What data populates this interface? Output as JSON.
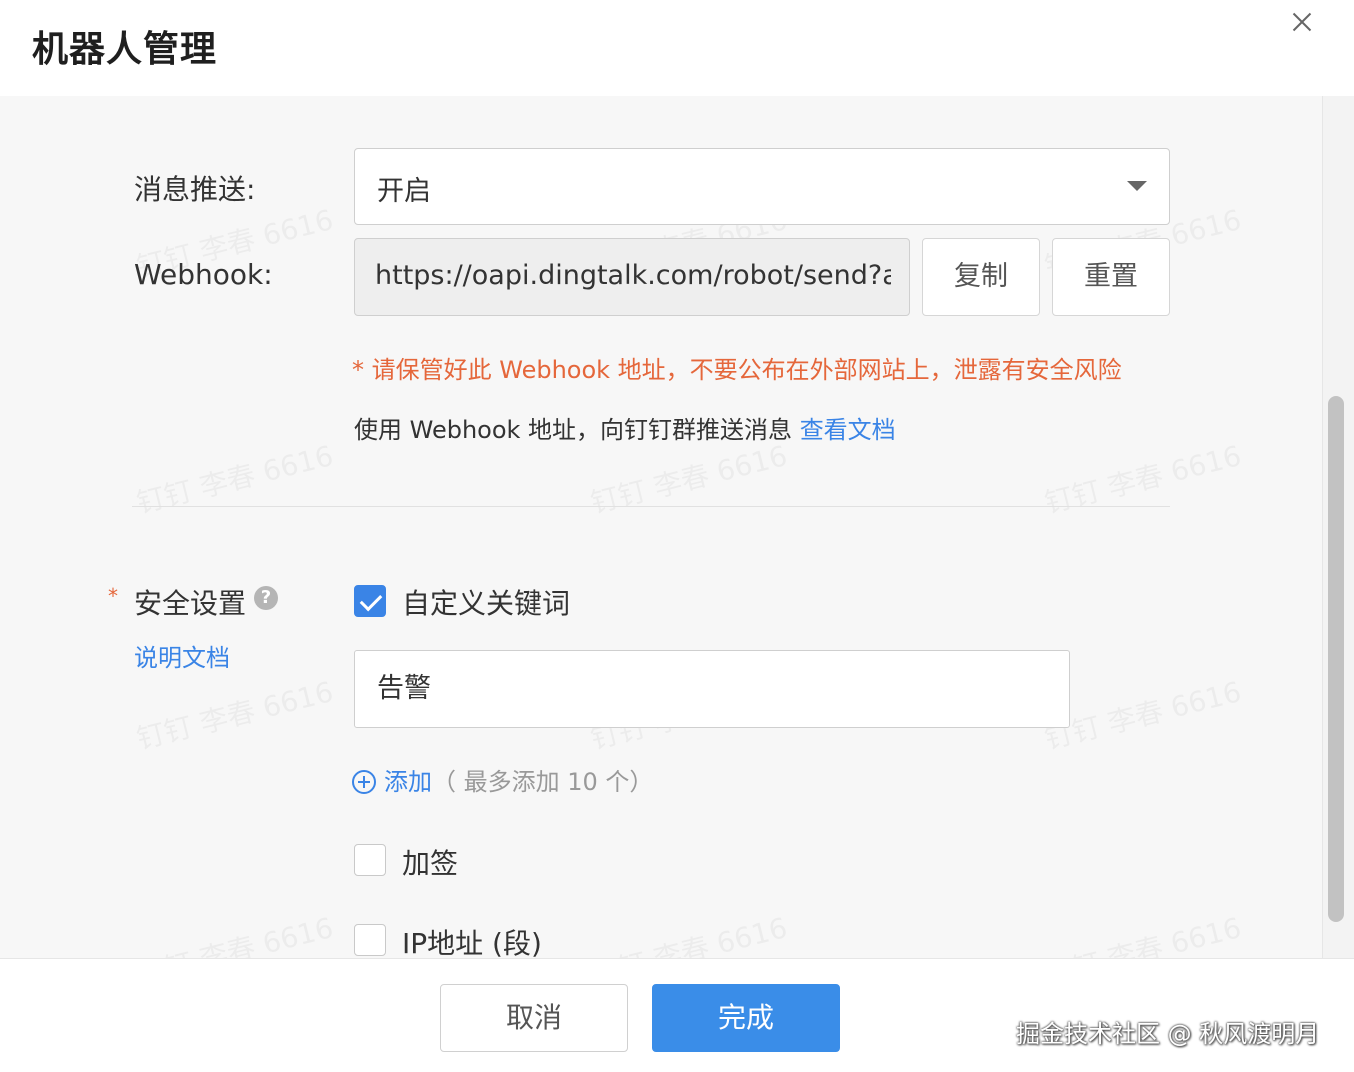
{
  "dialog": {
    "title": "机器人管理",
    "close_icon": "close-icon"
  },
  "watermark": {
    "text": "钉钉 李春 6616"
  },
  "push": {
    "label": "消息推送:",
    "value": "开启",
    "arrow_icon": "caret-down-icon"
  },
  "webhook": {
    "label": "Webhook:",
    "url": "https://oapi.dingtalk.com/robot/send?a",
    "copy_label": "复制",
    "reset_label": "重置",
    "warning": "* 请保管好此 Webhook 地址，不要公布在外部网站上，泄露有安全风险",
    "info_prefix": "使用 Webhook 地址，向钉钉群推送消息 ",
    "info_link": "查看文档"
  },
  "security": {
    "required_mark": "*",
    "label": "安全设置",
    "help_icon": "?",
    "doc_link": "说明文档",
    "options": [
      {
        "label": "自定义关键词",
        "checked": true
      },
      {
        "label": "加签",
        "checked": false
      },
      {
        "label": "IP地址 (段)",
        "checked": false
      }
    ],
    "keyword_value": "告警",
    "add_label": "添加",
    "add_hint": "（ 最多添加 10 个）"
  },
  "footer": {
    "cancel_label": "取消",
    "done_label": "完成",
    "credit": "掘金技术社区 @ 秋风渡明月"
  },
  "colors": {
    "accent": "#3a84e6",
    "warning": "#e5673b"
  }
}
